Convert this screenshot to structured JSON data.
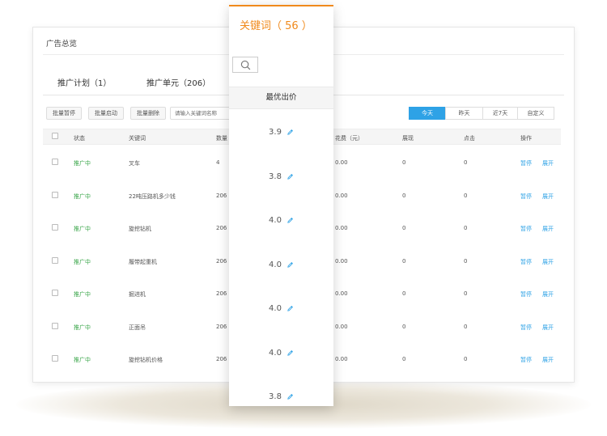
{
  "header": {
    "title": "广告总览"
  },
  "tabs": [
    {
      "label": "推广计划（1）"
    },
    {
      "label": "推广单元（206）"
    }
  ],
  "toolbar": {
    "pause_label": "批量暂停",
    "start_label": "批量启动",
    "delete_label": "批量删除",
    "search_placeholder": "请输入关键词名称"
  },
  "date_tabs": [
    {
      "label": "今天",
      "active": true
    },
    {
      "label": "昨天"
    },
    {
      "label": "近7天"
    },
    {
      "label": "自定义"
    }
  ],
  "table": {
    "columns": [
      "状态",
      "关键词",
      "数量",
      "花费（元）",
      "展现",
      "点击",
      "操作"
    ],
    "rows": [
      {
        "status": "推广中",
        "keyword": "叉车",
        "count": "4",
        "cost": "0.00",
        "impressions": "0",
        "clicks": "0",
        "op_pause": "暂停",
        "op_expand": "展开"
      },
      {
        "status": "推广中",
        "keyword": "22吨压路机多少钱",
        "count": "206",
        "cost": "0.00",
        "impressions": "0",
        "clicks": "0",
        "op_pause": "暂停",
        "op_expand": "展开"
      },
      {
        "status": "推广中",
        "keyword": "旋挖钻机",
        "count": "206",
        "cost": "0.00",
        "impressions": "0",
        "clicks": "0",
        "op_pause": "暂停",
        "op_expand": "展开"
      },
      {
        "status": "推广中",
        "keyword": "履带起重机",
        "count": "206",
        "cost": "0.00",
        "impressions": "0",
        "clicks": "0",
        "op_pause": "暂停",
        "op_expand": "展开"
      },
      {
        "status": "推广中",
        "keyword": "掘进机",
        "count": "206",
        "cost": "0.00",
        "impressions": "0",
        "clicks": "0",
        "op_pause": "暂停",
        "op_expand": "展开"
      },
      {
        "status": "推广中",
        "keyword": "正面吊",
        "count": "206",
        "cost": "0.00",
        "impressions": "0",
        "clicks": "0",
        "op_pause": "暂停",
        "op_expand": "展开"
      },
      {
        "status": "推广中",
        "keyword": "旋挖钻机价格",
        "count": "206",
        "cost": "0.00",
        "impressions": "0",
        "clicks": "0",
        "op_pause": "暂停",
        "op_expand": "展开"
      }
    ]
  },
  "panel": {
    "title": "关键词（ 56 ）",
    "column_header": "最优出价",
    "prices": [
      "3.9",
      "3.8",
      "4.0",
      "4.0",
      "4.0",
      "4.0",
      "3.8"
    ]
  },
  "colors": {
    "accent": "#2ea2e6",
    "panel_accent": "#f08a1c",
    "status_green": "#3aa64a"
  },
  "icons": {
    "search": "search-icon",
    "edit": "pencil-icon"
  }
}
